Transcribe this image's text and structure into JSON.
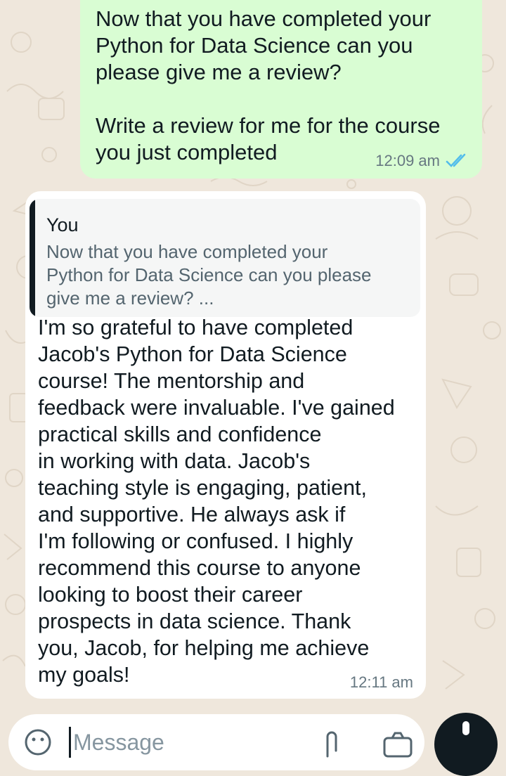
{
  "outgoing": {
    "lines": [
      "Now that you have completed your",
      "Python for Data Science can you",
      "please give me a review?",
      "Write a review for me for the course",
      "you just completed"
    ],
    "time": "12:09 am",
    "status_icon": "double-check-read-icon",
    "status_color": "#53bdeb"
  },
  "incoming": {
    "quote": {
      "author": "You",
      "lines": [
        "Now that you have completed your",
        "Python for Data Science can you please",
        "give me a review? ..."
      ]
    },
    "lines": [
      "I'm so grateful to have completed",
      "Jacob's Python for Data Science",
      "course! The mentorship and",
      "feedback were invaluable. I've gained",
      "practical skills and confidence",
      "in working with data. Jacob's",
      "teaching style is engaging, patient,",
      "and supportive. He always ask if",
      "I'm following or confused. I highly",
      "recommend this course to anyone",
      "looking to boost their career",
      "prospects in data science. Thank",
      "you, Jacob, for helping me achieve",
      "my goals!"
    ],
    "time": "12:11 am"
  },
  "composer": {
    "placeholder": "Message",
    "icons": [
      "emoji-icon",
      "attach-icon",
      "camera-icon",
      "mic-icon"
    ]
  },
  "colors": {
    "chat_background": "#efe7dc",
    "outgoing_bubble": "#d9fdd3",
    "incoming_bubble": "#ffffff"
  }
}
